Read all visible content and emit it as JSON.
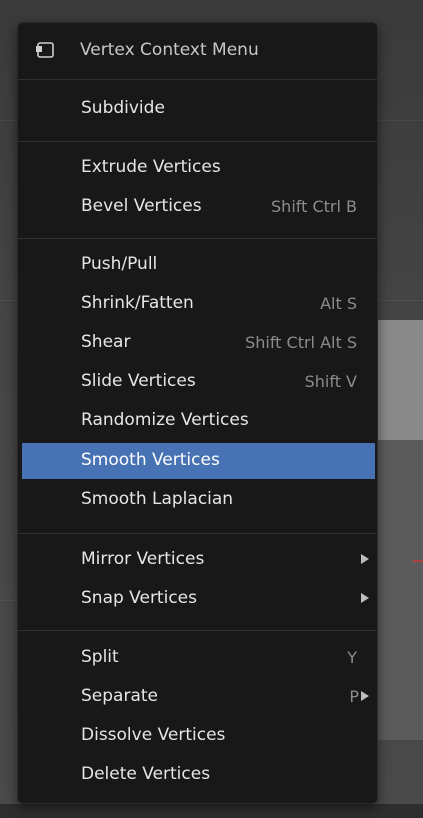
{
  "menu": {
    "title": "Vertex Context Menu",
    "header_icon": "menu-panel-icon",
    "groups": [
      {
        "items": [
          {
            "label": "Subdivide",
            "shortcut": ""
          }
        ]
      },
      {
        "items": [
          {
            "label": "Extrude Vertices",
            "shortcut": ""
          },
          {
            "label": "Bevel Vertices",
            "shortcut": "Shift Ctrl B"
          }
        ]
      },
      {
        "items": [
          {
            "label": "Push/Pull",
            "shortcut": ""
          },
          {
            "label": "Shrink/Fatten",
            "shortcut": "Alt S"
          },
          {
            "label": "Shear",
            "shortcut": "Shift Ctrl Alt S"
          },
          {
            "label": "Slide Vertices",
            "shortcut": "Shift V"
          },
          {
            "label": "Randomize Vertices",
            "shortcut": ""
          },
          {
            "label": "Smooth Vertices",
            "shortcut": "",
            "highlighted": true
          },
          {
            "label": "Smooth Laplacian",
            "shortcut": ""
          }
        ]
      },
      {
        "items": [
          {
            "label": "Mirror Vertices",
            "shortcut": "",
            "submenu": true
          },
          {
            "label": "Snap Vertices",
            "shortcut": "",
            "submenu": true
          }
        ]
      },
      {
        "items": [
          {
            "label": "Split",
            "shortcut": "Y"
          },
          {
            "label": "Separate",
            "shortcut": "P",
            "submenu": true
          },
          {
            "label": "Dissolve Vertices",
            "shortcut": ""
          },
          {
            "label": "Delete Vertices",
            "shortcut": ""
          }
        ]
      }
    ]
  },
  "colors": {
    "menu_bg": "#181818",
    "highlight": "#4772b3",
    "text": "#e6e6e6",
    "shortcut_text": "#8c8c8c",
    "separator": "#303030"
  }
}
